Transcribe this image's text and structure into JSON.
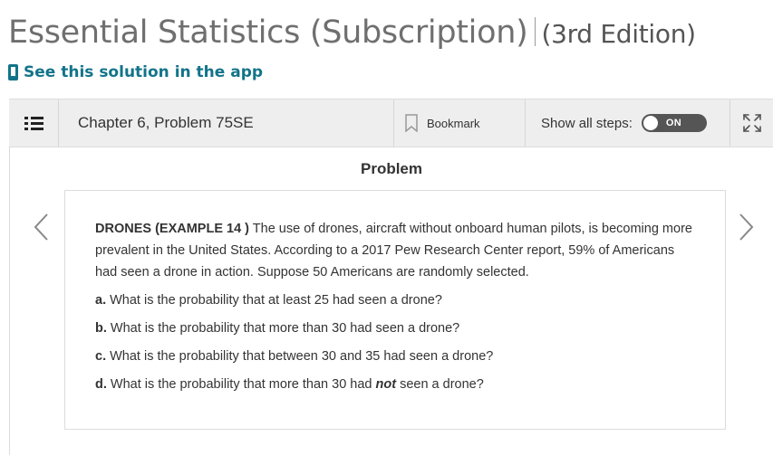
{
  "header": {
    "book_title": "Essential Statistics (Subscription)",
    "edition": "(3rd Edition)",
    "app_link": "See this solution in the app"
  },
  "toolbar": {
    "chapter_label": "Chapter 6, Problem 75SE",
    "bookmark_label": "Bookmark",
    "show_steps_label": "Show all steps:",
    "toggle_text": "ON"
  },
  "problem": {
    "heading": "Problem",
    "intro_bold": "DRONES (EXAMPLE 14 )",
    "intro_text": " The use of drones, aircraft without onboard human pilots, is becoming more prevalent in the United States. According to a 2017 Pew Research Center report, 59% of Americans had seen a drone in action. Suppose 50 Americans are randomly selected.",
    "questions": [
      {
        "letter": "a.",
        "text": " What is the probability that at least 25 had seen a drone?"
      },
      {
        "letter": "b.",
        "text": " What is the probability that more than 30 had seen a drone?"
      },
      {
        "letter": "c.",
        "text": " What is the probability that between 30 and 35 had seen a drone?"
      },
      {
        "letter": "d.",
        "text_before": " What is the probability that more than 30 had ",
        "emph": "not",
        "text_after": " seen a drone?"
      }
    ]
  }
}
